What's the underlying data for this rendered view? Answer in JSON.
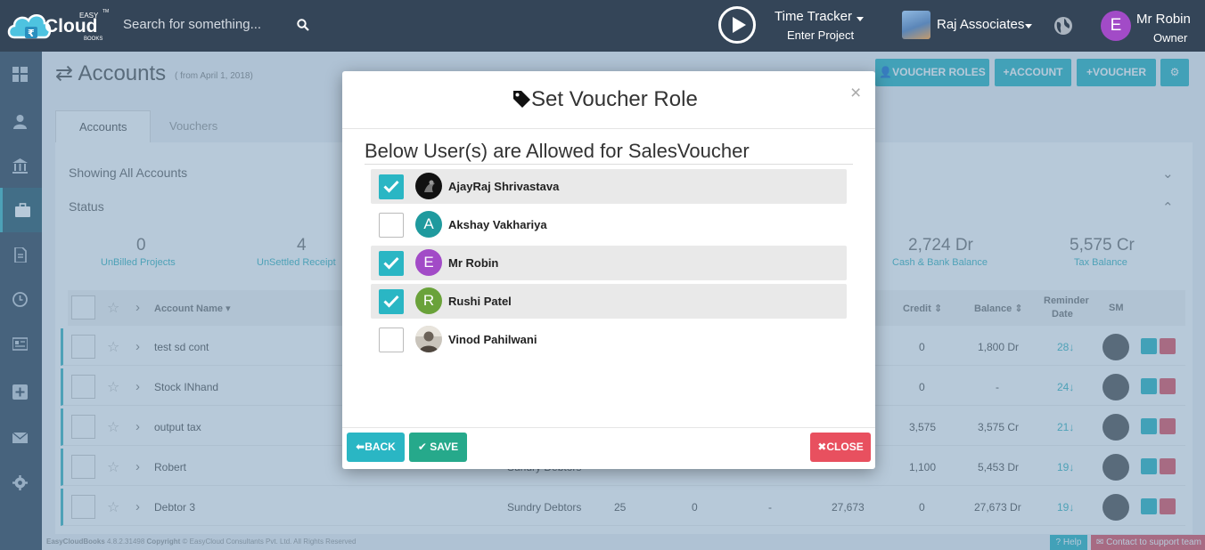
{
  "topbar": {
    "logo": {
      "easy": "EASY",
      "cloud": "Cloud",
      "books": "BOOKS",
      "tm": "TM"
    },
    "search_placeholder": "Search for something...",
    "time_tracker": {
      "title": "Time Tracker",
      "subtitle": "Enter Project"
    },
    "company": {
      "name": "Raj Associates"
    },
    "user": {
      "initial": "E",
      "name": "Mr Robin",
      "role": "Owner",
      "avatar_color": "#a24bc7"
    }
  },
  "sidebar": {
    "icons": [
      "dashboard-icon",
      "user-icon",
      "bank-icon",
      "briefcase-icon",
      "document-icon",
      "clock-icon",
      "report-icon",
      "plus-icon",
      "mail-icon",
      "gear-icon"
    ],
    "active_index": 3
  },
  "page": {
    "title": "Accounts",
    "title_sub": "( from April 1, 2018)",
    "buttons": {
      "voucher_roles": "VOUCHER ROLES",
      "account": "ACCOUNT",
      "voucher": "VOUCHER"
    },
    "tabs": [
      "Accounts",
      "Vouchers"
    ],
    "filters": {
      "showing": "Showing All Accounts",
      "status": "Status"
    },
    "stats": [
      {
        "value": "0",
        "label": "UnBilled Projects"
      },
      {
        "value": "4",
        "label": "UnSettled Receipt"
      },
      {
        "value": "2,724 Dr",
        "label": "Cash & Bank Balance"
      },
      {
        "value": "5,575 Cr",
        "label": "Tax Balance"
      }
    ],
    "table": {
      "headers": {
        "account_name": "Account Name",
        "credit": "Credit",
        "balance": "Balance",
        "reminder": "Reminder",
        "date": "Date",
        "sm": "SM"
      },
      "rows": [
        {
          "name": "test sd cont",
          "group": "",
          "c3": "",
          "c4": "",
          "c5": "",
          "c6": "",
          "credit": "0",
          "balance": "1,800 Dr",
          "reminder": "28"
        },
        {
          "name": "Stock INhand",
          "group": "",
          "c3": "",
          "c4": "",
          "c5": "",
          "c6": "",
          "credit": "0",
          "balance": "-",
          "reminder": "24"
        },
        {
          "name": "output tax",
          "group": "",
          "c3": "",
          "c4": "",
          "c5": "",
          "c6": "",
          "credit": "3,575",
          "balance": "3,575 Cr",
          "reminder": "21"
        },
        {
          "name": "Robert",
          "group": "Sundry Debtors",
          "c3": "",
          "c4": "",
          "c5": "",
          "c6": "",
          "credit": "1,100",
          "balance": "5,453 Dr",
          "reminder": "19"
        },
        {
          "name": "Debtor 3",
          "group": "Sundry Debtors",
          "c3": "25",
          "c4": "0",
          "c5": "-",
          "c6": "27,673",
          "credit": "0",
          "balance": "27,673 Dr",
          "reminder": "19"
        }
      ]
    },
    "footer": {
      "app": "EasyCloudBooks",
      "version": "4.8.2.31498",
      "copyright": "Copyright",
      "company": "© EasyCloud Consultants Pvt. Ltd. All Rights Reserved",
      "help": "Help",
      "support": "Contact to support team"
    }
  },
  "modal": {
    "title": "Set Voucher Role",
    "close_x": "×",
    "subtitle": "Below User(s) are Allowed for SalesVoucher",
    "users": [
      {
        "name": "AjayRaj Shrivastava",
        "checked": true,
        "initial": "",
        "avatar_color": "#111111",
        "photo": true
      },
      {
        "name": "Akshay Vakhariya",
        "checked": false,
        "initial": "A",
        "avatar_color": "#1f9a9e",
        "photo": false
      },
      {
        "name": "Mr Robin",
        "checked": true,
        "initial": "E",
        "avatar_color": "#a24bc7",
        "photo": false
      },
      {
        "name": "Rushi Patel",
        "checked": true,
        "initial": "R",
        "avatar_color": "#6aa23a",
        "photo": false
      },
      {
        "name": "Vinod Pahilwani",
        "checked": false,
        "initial": "",
        "avatar_color": "#6b6258",
        "photo": true
      }
    ],
    "buttons": {
      "back": "BACK",
      "save": "SAVE",
      "close": "CLOSE"
    },
    "colors": {
      "back": "#2ab6c4",
      "save": "#26a98b",
      "close": "#e8505f"
    }
  }
}
